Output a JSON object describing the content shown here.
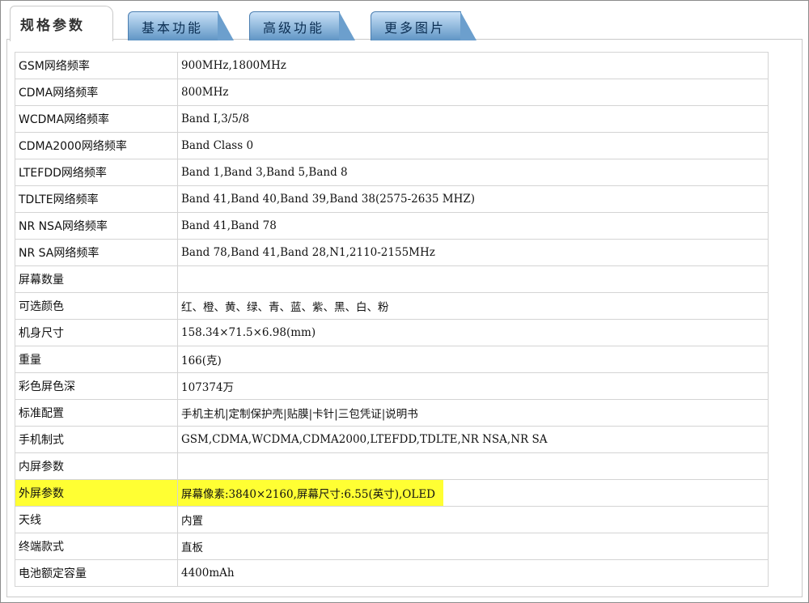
{
  "tabs": [
    {
      "label": "规格参数",
      "active": true
    },
    {
      "label": "基本功能",
      "active": false
    },
    {
      "label": "高级功能",
      "active": false
    },
    {
      "label": "更多图片",
      "active": false
    }
  ],
  "specs": [
    {
      "key": "GSM网络频率",
      "value": "900MHz,1800MHz"
    },
    {
      "key": "CDMA网络频率",
      "value": "800MHz"
    },
    {
      "key": "WCDMA网络频率",
      "value": "Band Ⅰ,3/5/8"
    },
    {
      "key": "CDMA2000网络频率",
      "value": "Band Class 0"
    },
    {
      "key": "LTEFDD网络频率",
      "value": "Band 1,Band 3,Band 5,Band 8"
    },
    {
      "key": "TDLTE网络频率",
      "value": "Band 41,Band 40,Band 39,Band 38(2575-2635 MHZ)"
    },
    {
      "key": "NR NSA网络频率",
      "value": "Band 41,Band 78"
    },
    {
      "key": "NR SA网络频率",
      "value": "Band 78,Band 41,Band 28,N1,2110-2155MHz"
    },
    {
      "key": "屏幕数量",
      "value": ""
    },
    {
      "key": "可选颜色",
      "value": "红、橙、黄、绿、青、蓝、紫、黑、白、粉"
    },
    {
      "key": "机身尺寸",
      "value": "158.34×71.5×6.98(mm)"
    },
    {
      "key": "重量",
      "value": "166(克)"
    },
    {
      "key": "彩色屏色深",
      "value": "107374万"
    },
    {
      "key": "标准配置",
      "value": "手机主机|定制保护壳|贴膜|卡针|三包凭证|说明书"
    },
    {
      "key": "手机制式",
      "value": "GSM,CDMA,WCDMA,CDMA2000,LTEFDD,TDLTE,NR NSA,NR SA"
    },
    {
      "key": "内屏参数",
      "value": ""
    },
    {
      "key": "外屏参数",
      "value": "屏幕像素:3840×2160,屏幕尺寸:6.55(英寸),OLED",
      "highlight": true
    },
    {
      "key": "天线",
      "value": "内置"
    },
    {
      "key": "终端款式",
      "value": "直板"
    },
    {
      "key": "电池额定容量",
      "value": "4400mAh"
    }
  ],
  "colors": {
    "highlight": "#ffff33",
    "tab_blue": "#5f95c5",
    "border": "#d4d4d4"
  }
}
